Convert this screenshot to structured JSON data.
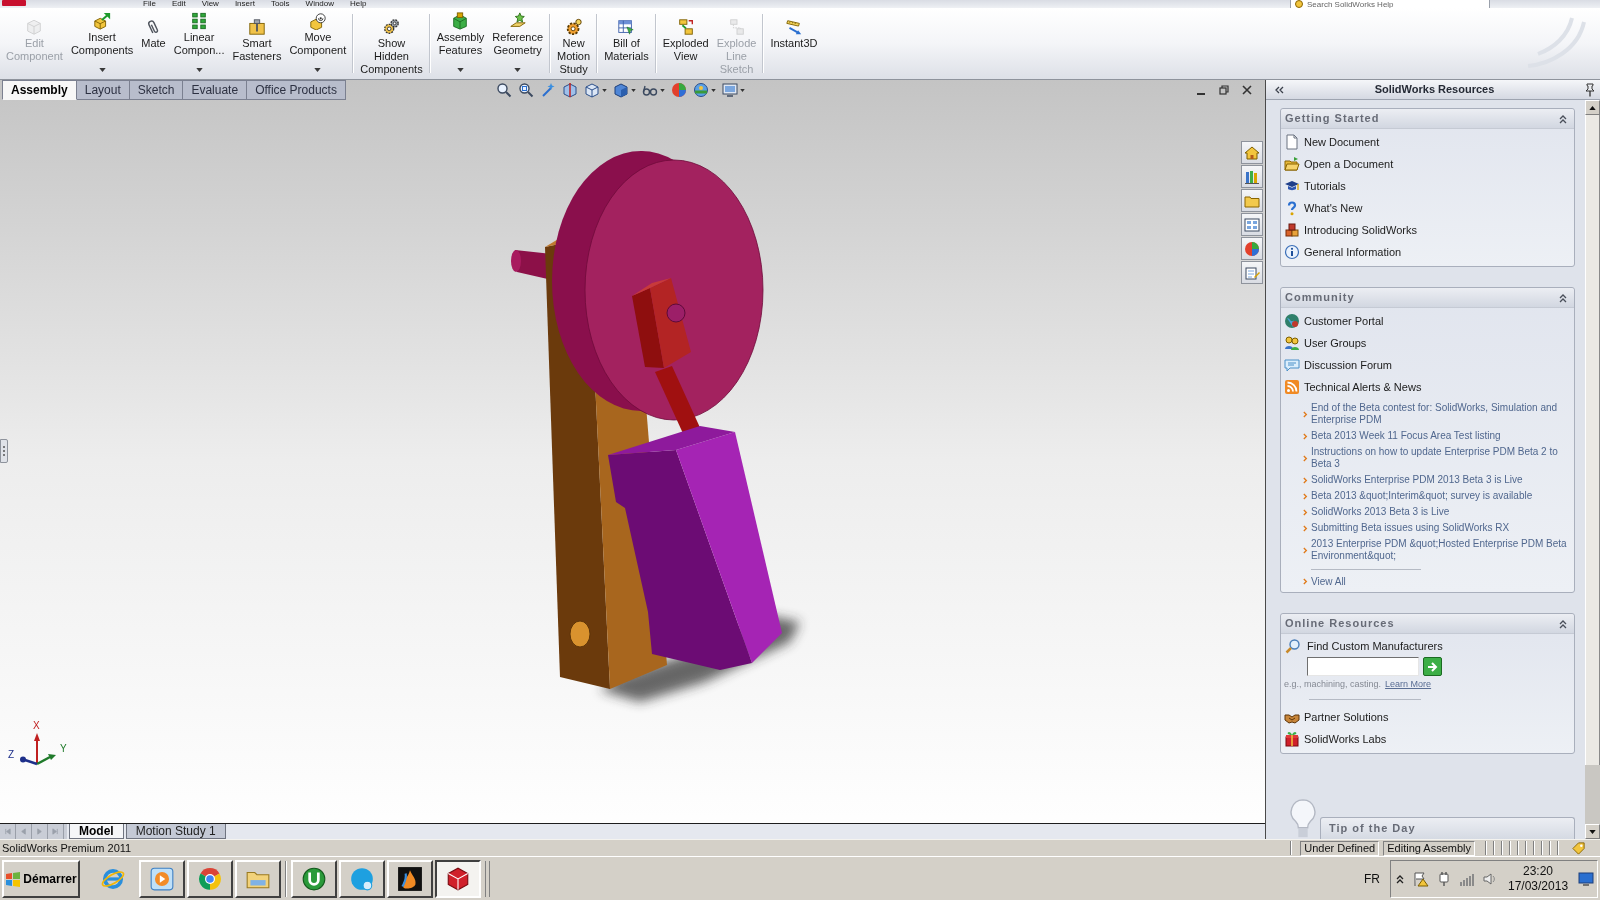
{
  "menu_bar": {
    "items": [
      "File",
      "Edit",
      "View",
      "Insert",
      "Tools",
      "Window",
      "Help"
    ],
    "search": {
      "placeholder": "Search SolidWorks Help"
    }
  },
  "command_manager": {
    "groups": [
      [
        {
          "label": "Edit\nComponent",
          "disabled": true,
          "has_menu": false
        },
        {
          "label": "Insert\nComponents",
          "disabled": false,
          "has_menu": true
        },
        {
          "label": "Mate",
          "disabled": false,
          "has_menu": false
        },
        {
          "label": "Linear\nCompon...",
          "disabled": false,
          "has_menu": true
        },
        {
          "label": "Smart\nFasteners",
          "disabled": false,
          "has_menu": false
        },
        {
          "label": "Move\nComponent",
          "disabled": false,
          "has_menu": true
        }
      ],
      [
        {
          "label": "Show\nHidden\nComponents",
          "disabled": false,
          "has_menu": false
        }
      ],
      [
        {
          "label": "Assembly\nFeatures",
          "disabled": false,
          "has_menu": true
        },
        {
          "label": "Reference\nGeometry",
          "disabled": false,
          "has_menu": true
        }
      ],
      [
        {
          "label": "New\nMotion\nStudy",
          "disabled": false,
          "has_menu": false
        }
      ],
      [
        {
          "label": "Bill of\nMaterials",
          "disabled": false,
          "has_menu": false
        }
      ],
      [
        {
          "label": "Exploded\nView",
          "disabled": false,
          "has_menu": false
        },
        {
          "label": "Explode\nLine\nSketch",
          "disabled": true,
          "has_menu": false
        }
      ],
      [
        {
          "label": "Instant3D",
          "disabled": false,
          "has_menu": false
        }
      ]
    ],
    "tabs": [
      {
        "label": "Assembly",
        "selected": true
      },
      {
        "label": "Layout",
        "selected": false
      },
      {
        "label": "Sketch",
        "selected": false
      },
      {
        "label": "Evaluate",
        "selected": false
      },
      {
        "label": "Office Products",
        "selected": false
      }
    ]
  },
  "graphics_area": {
    "triad": {
      "x": "X",
      "y": "Y",
      "z": "Z"
    }
  },
  "resources_panel": {
    "title": "SolidWorks Resources",
    "sections": [
      {
        "title": "Getting Started",
        "expanded": true,
        "links": [
          "New Document",
          "Open a Document",
          "Tutorials",
          "What's New",
          "Introducing SolidWorks",
          "General Information"
        ]
      },
      {
        "title": "Community",
        "expanded": true,
        "links": [
          "Customer Portal",
          "User Groups",
          "Discussion Forum",
          "Technical Alerts & News"
        ],
        "news": [
          "End of the Beta contest for: SolidWorks, Simulation and Enterprise PDM",
          "Beta 2013 Week 11 Focus Area Test listing",
          "Instructions on how to update Enterprise PDM Beta 2 to Beta 3",
          "SolidWorks Enterprise PDM 2013 Beta 3 is Live",
          "Beta 2013 &quot;Interim&quot; survey is available",
          "SolidWorks 2013 Beta 3 is Live",
          "Submitting Beta issues using SolidWorks RX",
          "2013 Enterprise PDM &quot;Hosted Enterprise PDM Beta Environment&quot;"
        ],
        "view_all": "View All"
      },
      {
        "title": "Online Resources",
        "expanded": true,
        "search": {
          "label": "Find Custom Manufacturers",
          "hint": "e.g., machining, casting.",
          "link": "Learn More"
        },
        "links": [
          "Partner Solutions",
          "SolidWorks Labs"
        ]
      }
    ],
    "tip": "Tip of the Day"
  },
  "document_tabs": [
    {
      "label": "Model",
      "selected": true
    },
    {
      "label": "Motion Study 1",
      "selected": false
    }
  ],
  "status_bar": {
    "product": "SolidWorks Premium 2011",
    "cells": [
      "Under Defined",
      "Editing Assembly"
    ]
  },
  "taskbar": {
    "start": "Démarrer",
    "apps": [
      {
        "selected": false
      },
      {
        "selected": false
      },
      {
        "selected": false
      },
      {
        "selected": false
      },
      {
        "selected": false
      },
      {
        "selected": false
      },
      {
        "selected": true
      }
    ],
    "language": "FR",
    "time": "23:20",
    "date": "17/03/2013"
  }
}
